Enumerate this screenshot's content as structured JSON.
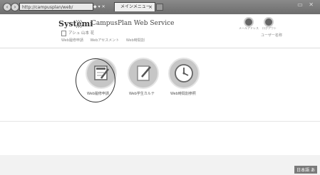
{
  "browser": {
    "address": "http://campusplan/web/",
    "tab_title": "メインメニュー",
    "tab_close": "×"
  },
  "header": {
    "logo_text": "Systemi",
    "logo_arrows": "〉〉〉",
    "brand": "CampusPlan Web Service",
    "sub_label": "アシュ 山本 花",
    "links": [
      "Web履修申請",
      "Webアセスメント",
      "Web時間割"
    ],
    "icons": [
      {
        "name": "gear-icon",
        "label": "メールアドレス"
      },
      {
        "name": "logout-icon",
        "label": "ログアウト"
      }
    ],
    "user_label": "ユーザー名称"
  },
  "functions": [
    {
      "label": "Web履修申請",
      "icon": "form-edit-icon"
    },
    {
      "label": "Web学生カルテ",
      "icon": "notepad-pencil-icon"
    },
    {
      "label": "Web時間割参照",
      "icon": "clock-icon"
    }
  ],
  "status": {
    "ime": "日本語 あ"
  }
}
